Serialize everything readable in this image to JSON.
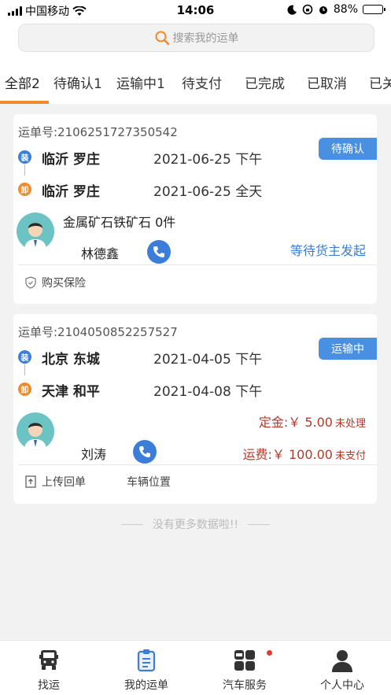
{
  "status_bar": {
    "carrier": "中国移动",
    "time": "14:06",
    "battery": "88%",
    "battery_level": 0.88
  },
  "search": {
    "placeholder": "搜索我的运单"
  },
  "tabs": [
    {
      "label": "全部2",
      "active": true
    },
    {
      "label": "待确认1",
      "active": false
    },
    {
      "label": "运输中1",
      "active": false
    },
    {
      "label": "待支付",
      "active": false
    },
    {
      "label": "已完成",
      "active": false
    },
    {
      "label": "已取消",
      "active": false
    },
    {
      "label": "已关",
      "active": false
    }
  ],
  "orders": [
    {
      "waybill": "运单号:2106251727350542",
      "badge": "待确认",
      "load_icon": "装",
      "unload_icon": "卸",
      "from": "临沂 罗庄",
      "from_date": "2021-06-25 下午",
      "to": "临沂 罗庄",
      "to_date": "2021-06-25 全天",
      "cargo": "金属矿石铁矿石  0件",
      "driver": "林德鑫",
      "status": "等待货主发起",
      "actions": [
        "购买保险"
      ]
    },
    {
      "waybill": "运单号:2104050852257527",
      "badge": "运输中",
      "load_icon": "装",
      "unload_icon": "卸",
      "from": "北京 东城",
      "from_date": "2021-04-05 下午",
      "to": "天津 和平",
      "to_date": "2021-04-08 下午",
      "deposit_label": "定金:￥ 5.00",
      "deposit_status": "未处理",
      "freight_label": "运费:￥ 100.00",
      "freight_status": "未支付",
      "driver": "刘涛",
      "actions": [
        "上传回单",
        "车辆位置"
      ]
    }
  ],
  "no_more": "没有更多数据啦!!",
  "bottom_nav": [
    {
      "label": "找运",
      "icon": "truck-icon"
    },
    {
      "label": "我的运单",
      "icon": "clipboard-icon",
      "active": true
    },
    {
      "label": "汽车服务",
      "icon": "grid-icon",
      "badge_dot": true
    },
    {
      "label": "个人中心",
      "icon": "person-icon"
    }
  ],
  "colors": {
    "accent": "#3b7dd8",
    "tab_underline": "#f08a2c",
    "fee": "#b33a2a",
    "badge": "#4a90e2"
  }
}
